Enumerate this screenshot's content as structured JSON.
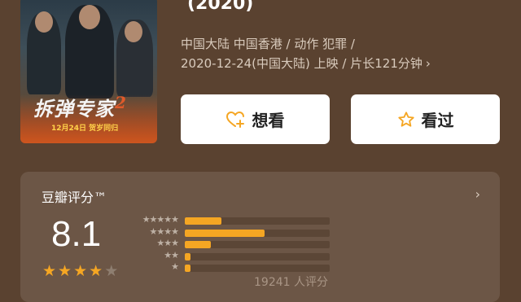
{
  "movie": {
    "year": "(2020)",
    "meta_line1": "中国大陆 中国香港 / 动作 犯罪 /",
    "meta_line2": "2020-12-24(中国大陆) 上映 / 片长121分钟",
    "meta_chevron": "›"
  },
  "poster": {
    "title": "拆弹专家",
    "title_number": "2",
    "date_text": "12月24日 贺岁同归"
  },
  "actions": {
    "want_label": "想看",
    "want_icon": "heart-plus-icon",
    "seen_label": "看过",
    "seen_icon": "star-outline-icon"
  },
  "rating": {
    "title": "豆瓣评分™",
    "chevron": "›",
    "score": "8.1",
    "stars": 4,
    "stars_max": 5,
    "count_text": "19241 人评分",
    "distribution": [
      {
        "stars": "★★★★★",
        "fraction": 0.25
      },
      {
        "stars": "★★★★",
        "fraction": 0.55
      },
      {
        "stars": "★★★",
        "fraction": 0.18
      },
      {
        "stars": "★★",
        "fraction": 0.04
      },
      {
        "stars": "★",
        "fraction": 0.04
      }
    ]
  },
  "colors": {
    "background": "#5a4230",
    "card": "#6c5646",
    "accent": "#f5a623"
  }
}
